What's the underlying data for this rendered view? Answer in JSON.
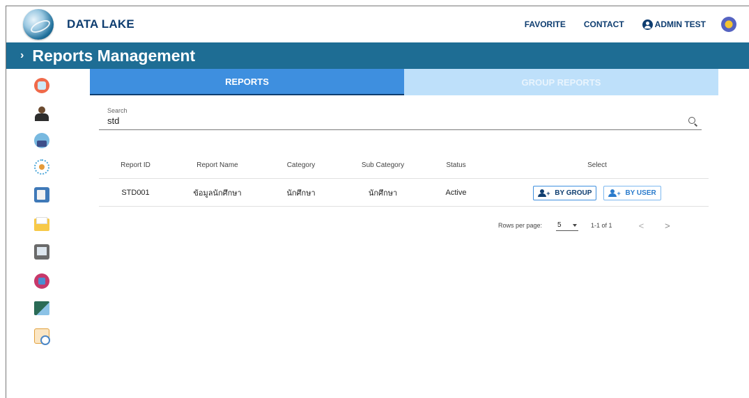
{
  "header": {
    "brand": "DATA LAKE",
    "nav": {
      "favorite": "FAVORITE",
      "contact": "CONTACT",
      "user": "ADMIN TEST"
    }
  },
  "page": {
    "title": "Reports Management"
  },
  "tabs": [
    {
      "label": "REPORTS",
      "active": true
    },
    {
      "label": "GROUP REPORTS",
      "active": false
    }
  ],
  "search": {
    "label": "Search",
    "value": "std"
  },
  "table": {
    "columns": [
      "Report ID",
      "Report Name",
      "Category",
      "Sub Category",
      "Status",
      "Select"
    ],
    "rows": [
      {
        "report_id": "STD001",
        "report_name": "ข้อมูลนักศึกษา",
        "category": "นักศึกษา",
        "sub_category": "นักศึกษา",
        "status": "Active",
        "actions": {
          "by_group": "BY GROUP",
          "by_user": "BY USER"
        }
      }
    ]
  },
  "pagination": {
    "rows_per_page_label": "Rows per page:",
    "rows_per_page": "5",
    "range": "1-1 of 1",
    "prev": "<",
    "next": ">"
  },
  "colors": {
    "title_bar": "#1e6d94",
    "tab_active": "#3e8fdf",
    "tab_inactive": "#bee0fa",
    "brand": "#0e3d70"
  },
  "icons": {
    "sidebar": [
      "app-icon-1",
      "admin-person-icon",
      "globe-people-icon",
      "network-icon",
      "report-clipboard-icon",
      "folder-icon",
      "monitor-report-icon",
      "add-user-icon",
      "cloud-server-icon",
      "clipboard-clock-icon"
    ]
  }
}
